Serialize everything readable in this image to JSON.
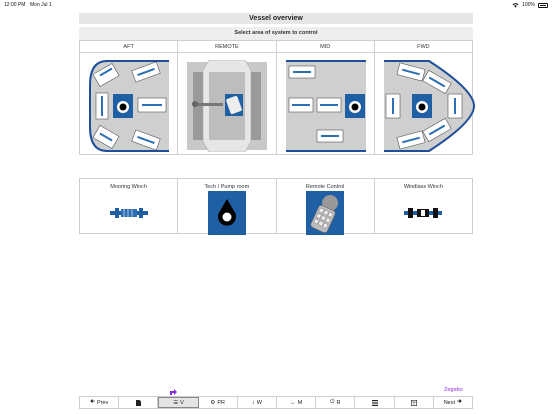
{
  "status": {
    "time": "12:00 PM",
    "date": "Mon Jul 1",
    "battery": "100%"
  },
  "header": {
    "title": "Vessel overview",
    "subtitle": "Select area of system to control"
  },
  "areas": [
    {
      "label": "AFT"
    },
    {
      "label": "REMOTE"
    },
    {
      "label": "MID"
    },
    {
      "label": "FWD"
    }
  ],
  "systems": [
    {
      "label": "Mooring Winch"
    },
    {
      "label": "Tech / Pump room"
    },
    {
      "label": "Remote Control"
    },
    {
      "label": "Windlass Winch"
    }
  ],
  "brand": "Zegebo",
  "nav": {
    "prev": "Prev",
    "v": "V",
    "pr": "PR",
    "w": "W",
    "m": "M",
    "r": "R",
    "next": "Next"
  },
  "colors": {
    "accent": "#1f5fa3",
    "tile_bg": "#cfcfcf",
    "hull": "#1f4f9a",
    "brand": "#8a2be2"
  }
}
